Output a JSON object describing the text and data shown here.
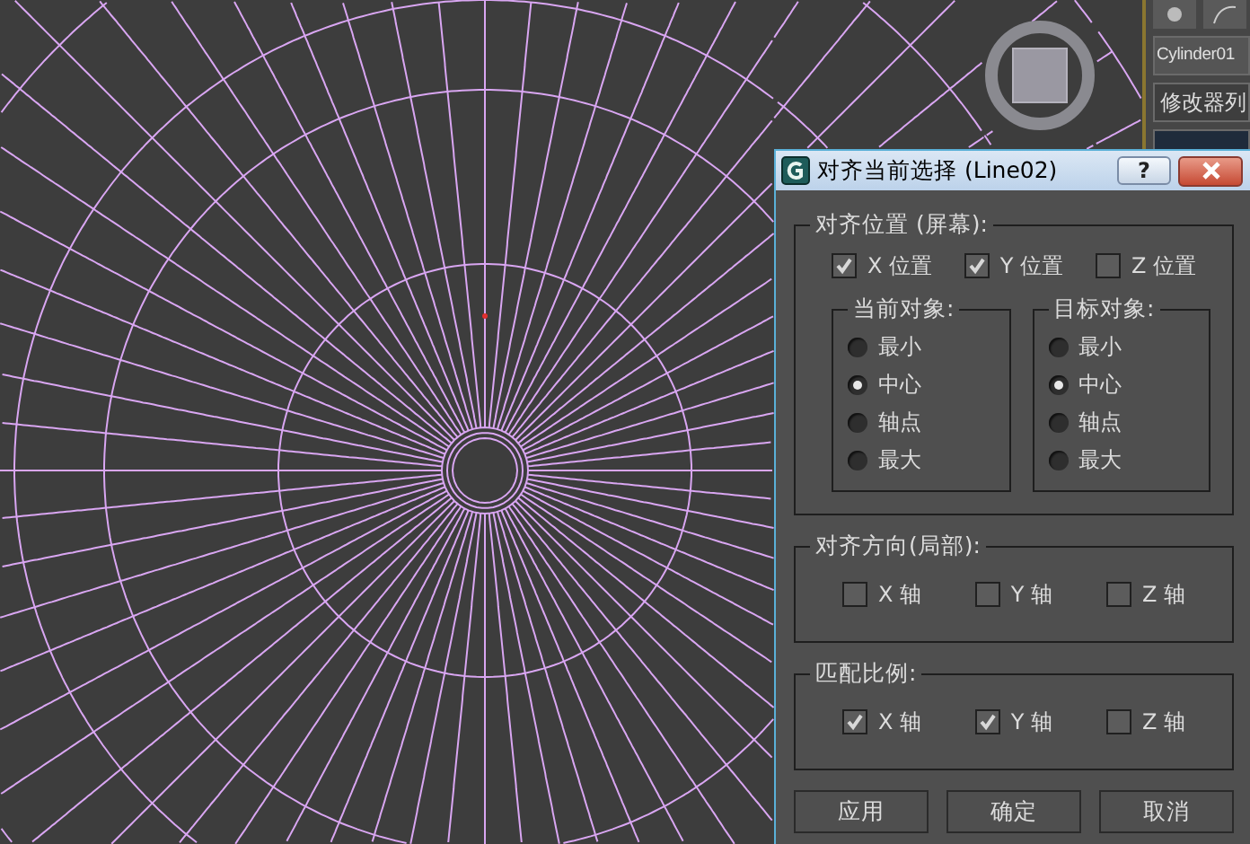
{
  "side_panel": {
    "object_name": "Cylinder01",
    "modifier_list": "修改器列"
  },
  "dialog": {
    "title": "对齐当前选择 (Line02)",
    "help": "?",
    "position_group": {
      "title": "对齐位置 (屏幕):",
      "axes": [
        {
          "label": "X 位置",
          "checked": true
        },
        {
          "label": "Y 位置",
          "checked": true
        },
        {
          "label": "Z 位置",
          "checked": false
        }
      ],
      "current_object": {
        "title": "当前对象:",
        "options": [
          {
            "label": "最小",
            "selected": false
          },
          {
            "label": "中心",
            "selected": true
          },
          {
            "label": "轴点",
            "selected": false
          },
          {
            "label": "最大",
            "selected": false
          }
        ]
      },
      "target_object": {
        "title": "目标对象:",
        "options": [
          {
            "label": "最小",
            "selected": false
          },
          {
            "label": "中心",
            "selected": true
          },
          {
            "label": "轴点",
            "selected": false
          },
          {
            "label": "最大",
            "selected": false
          }
        ]
      }
    },
    "orientation_group": {
      "title": "对齐方向(局部):",
      "axes": [
        {
          "label": "X 轴",
          "checked": false
        },
        {
          "label": "Y 轴",
          "checked": false
        },
        {
          "label": "Z 轴",
          "checked": false
        }
      ]
    },
    "scale_group": {
      "title": "匹配比例:",
      "axes": [
        {
          "label": "X 轴",
          "checked": true
        },
        {
          "label": "Y 轴",
          "checked": true
        },
        {
          "label": "Z 轴",
          "checked": false
        }
      ]
    },
    "buttons": [
      "应用",
      "确定",
      "取消"
    ]
  }
}
